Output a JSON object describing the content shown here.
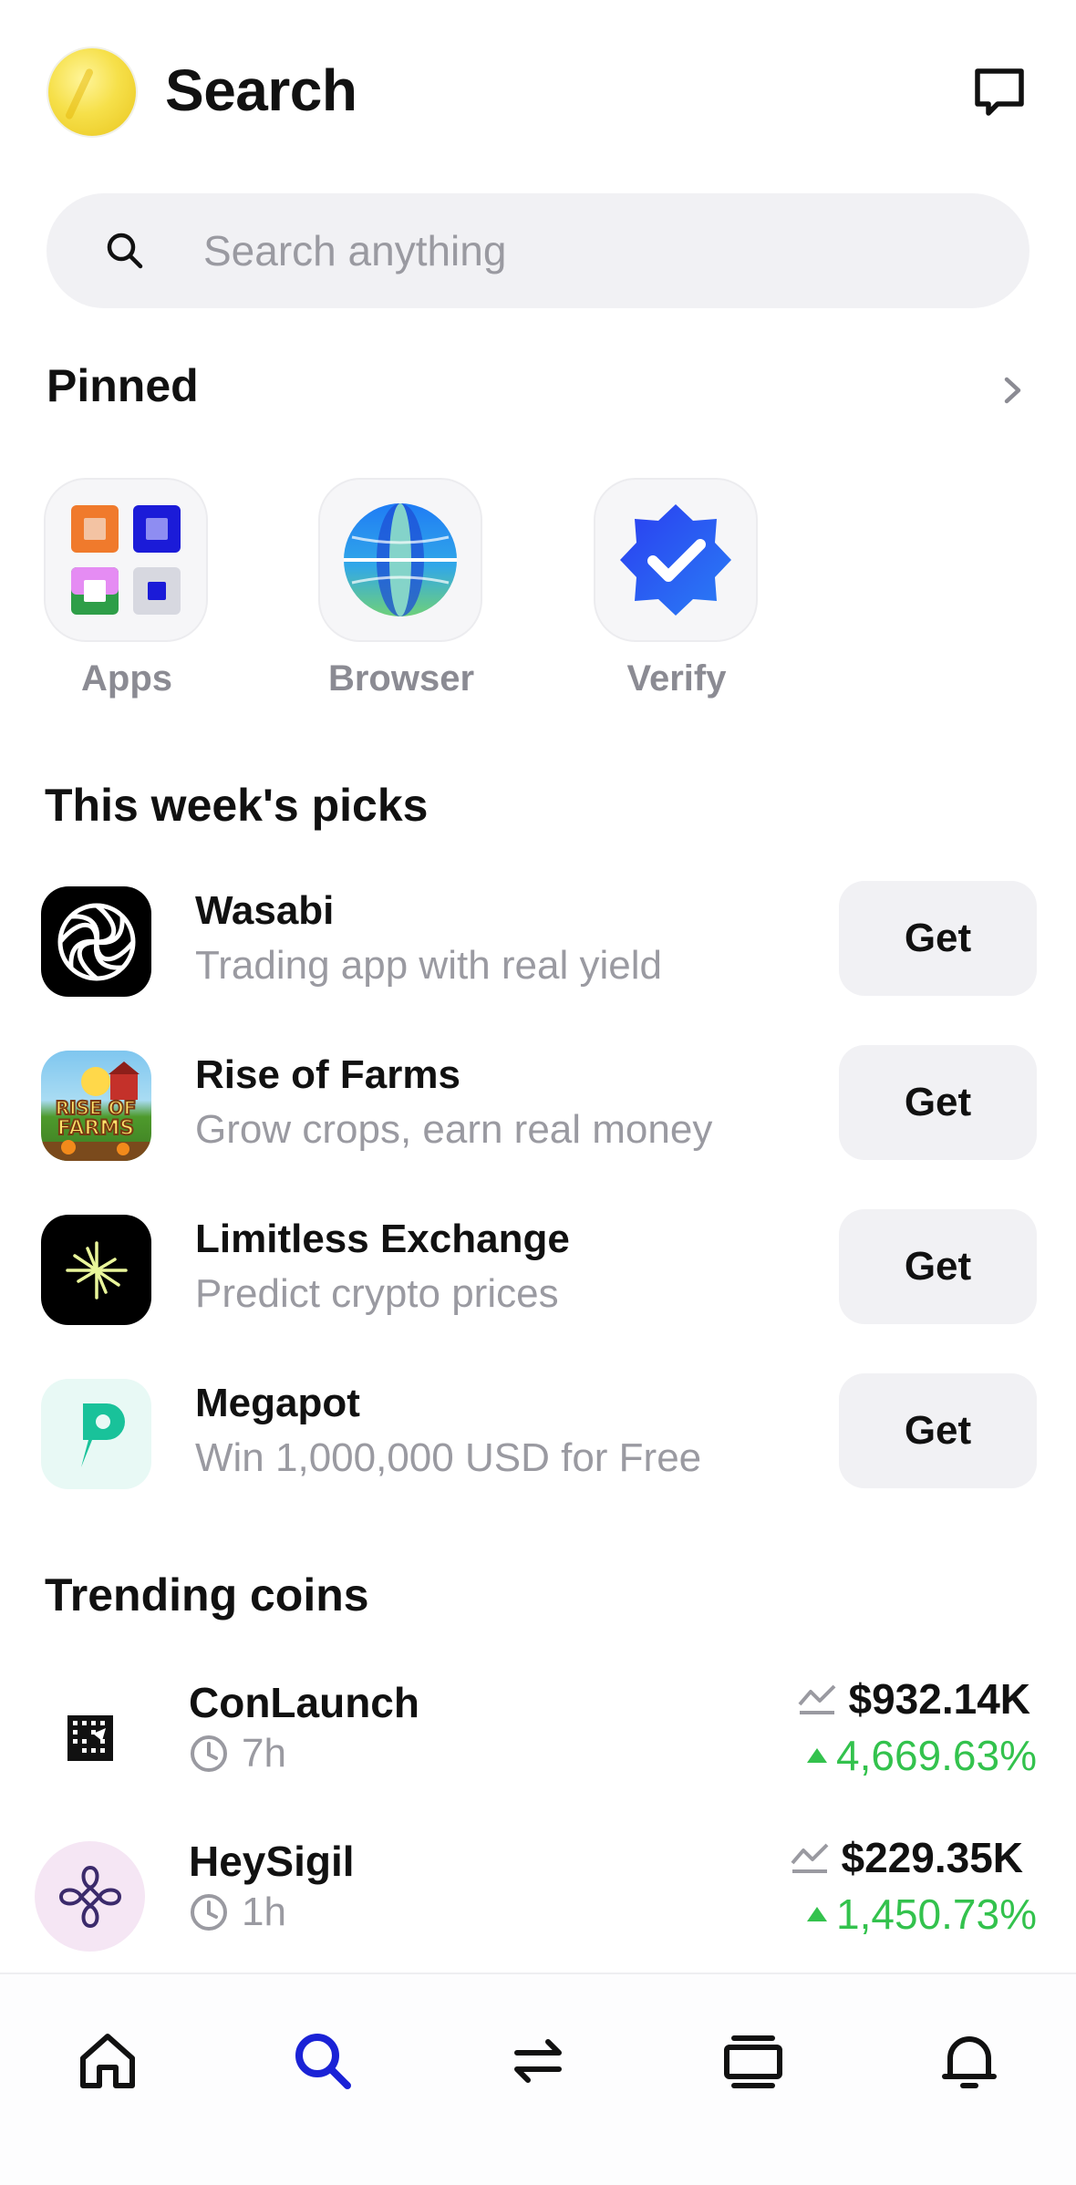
{
  "header": {
    "title": "Search",
    "avatar_icon": "coin-avatar",
    "chat_icon": "chat-icon"
  },
  "search": {
    "placeholder": "Search anything",
    "value": ""
  },
  "pinned": {
    "title": "Pinned",
    "items": [
      {
        "label": "Apps",
        "icon": "apps-grid-icon"
      },
      {
        "label": "Browser",
        "icon": "globe-icon"
      },
      {
        "label": "Verify",
        "icon": "verify-badge-icon"
      }
    ]
  },
  "picks": {
    "title": "This week's picks",
    "items": [
      {
        "name": "Wasabi",
        "description": "Trading app with real yield",
        "button": "Get",
        "icon": "wasabi-logo"
      },
      {
        "name": "Rise of Farms",
        "description": "Grow crops, earn real money",
        "button": "Get",
        "icon": "rise-of-farms-logo"
      },
      {
        "name": "Limitless Exchange",
        "description": "Predict crypto prices",
        "button": "Get",
        "icon": "limitless-logo"
      },
      {
        "name": "Megapot",
        "description": "Win 1,000,000 USD for Free",
        "button": "Get",
        "icon": "megapot-logo"
      }
    ],
    "farm_logo_text": [
      "RISE OF",
      "FARMS"
    ]
  },
  "coins": {
    "title": "Trending coins",
    "items": [
      {
        "name": "ConLaunch",
        "age": "7h",
        "market_cap": "$932.14K",
        "change": "4,669.63%",
        "direction": "up"
      },
      {
        "name": "HeySigil",
        "age": "1h",
        "market_cap": "$229.35K",
        "change": "1,450.73%",
        "direction": "up"
      }
    ]
  },
  "nav": {
    "items": [
      {
        "id": "home",
        "icon": "home-icon"
      },
      {
        "id": "search",
        "icon": "search-icon",
        "active": true
      },
      {
        "id": "swap",
        "icon": "swap-arrows-icon"
      },
      {
        "id": "cards",
        "icon": "cards-stack-icon"
      },
      {
        "id": "notifications",
        "icon": "bell-icon"
      }
    ]
  },
  "colors": {
    "accent": "#1a22d6",
    "positive": "#33c24d",
    "muted": "#9a9aa1",
    "surface": "#f1f1f4"
  }
}
